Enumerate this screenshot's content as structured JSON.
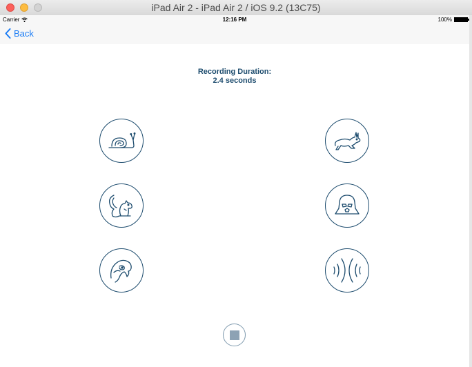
{
  "window": {
    "title": "iPad Air 2 - iPad Air 2 / iOS 9.2 (13C75)"
  },
  "status_bar": {
    "carrier": "Carrier",
    "time": "12:16 PM",
    "battery": "100%"
  },
  "nav": {
    "back_label": "Back"
  },
  "recording": {
    "label": "Recording Duration:",
    "value": "2.4 seconds"
  },
  "voice_buttons": [
    {
      "name": "snail",
      "icon": "snail-icon"
    },
    {
      "name": "rabbit",
      "icon": "rabbit-icon"
    },
    {
      "name": "chipmunk",
      "icon": "chipmunk-icon"
    },
    {
      "name": "darth-vader",
      "icon": "vader-icon"
    },
    {
      "name": "parrot",
      "icon": "parrot-icon"
    },
    {
      "name": "reverb",
      "icon": "reverb-icon"
    }
  ],
  "stop_button": {
    "icon": "stop-icon"
  },
  "colors": {
    "accent": "#1d4c6e",
    "link": "#1a7cf5",
    "stop_fill": "#8da2b4"
  }
}
